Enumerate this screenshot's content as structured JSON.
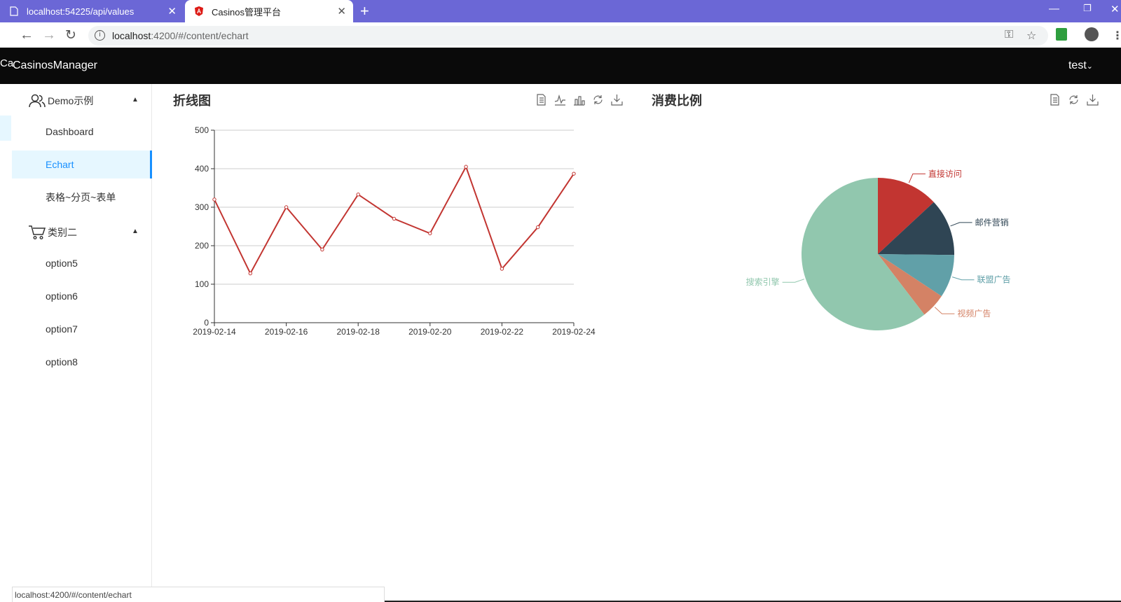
{
  "browser": {
    "tabs": [
      {
        "title": "localhost:54225/api/values"
      },
      {
        "title": "Casinos管理平台"
      }
    ],
    "url_host": "localhost",
    "url_path": ":4200/#/content/echart",
    "status_url": "localhost:4200/#/content/echart"
  },
  "header": {
    "brand_clip": "Ca",
    "brand": "CasinosManager",
    "user": "test"
  },
  "sidebar": {
    "groups": [
      {
        "label": "Demo示例",
        "icon": "users-icon"
      },
      {
        "label": "类别二",
        "icon": "cart-icon"
      }
    ],
    "items": [
      {
        "label": "Dashboard"
      },
      {
        "label": "Echart",
        "active": true
      },
      {
        "label": "表格~分页~表单"
      },
      {
        "label": "option5"
      },
      {
        "label": "option6"
      },
      {
        "label": "option7"
      },
      {
        "label": "option8"
      }
    ]
  },
  "line_card": {
    "title": "折线图"
  },
  "pie_card": {
    "title": "消费比例"
  },
  "colors": {
    "accent": "#1890ff",
    "header": "#0a0a0a",
    "tabstrip": "#6b67d6"
  },
  "chart_data": [
    {
      "type": "line",
      "title": "折线图",
      "x": [
        "2019-02-14",
        "2019-02-15",
        "2019-02-16",
        "2019-02-17",
        "2019-02-18",
        "2019-02-19",
        "2019-02-20",
        "2019-02-21",
        "2019-02-22",
        "2019-02-23",
        "2019-02-24"
      ],
      "xticks": [
        "2019-02-14",
        "2019-02-16",
        "2019-02-18",
        "2019-02-20",
        "2019-02-22",
        "2019-02-24"
      ],
      "series": [
        {
          "values": [
            320,
            128,
            300,
            190,
            333,
            270,
            232,
            405,
            140,
            248,
            387
          ],
          "color": "#c23531"
        }
      ],
      "ylim": [
        0,
        500
      ],
      "yticks": [
        0,
        100,
        200,
        300,
        400,
        500
      ],
      "grid": true
    },
    {
      "type": "pie",
      "title": "消费比例",
      "slices": [
        {
          "name": "直接访问",
          "value": 335,
          "color": "#c23531"
        },
        {
          "name": "邮件营销",
          "value": 310,
          "color": "#2f4554"
        },
        {
          "name": "联盟广告",
          "value": 234,
          "color": "#61a0a8"
        },
        {
          "name": "视频广告",
          "value": 135,
          "color": "#d48265"
        },
        {
          "name": "搜索引擎",
          "value": 1548,
          "color": "#91c7ae"
        }
      ]
    }
  ]
}
